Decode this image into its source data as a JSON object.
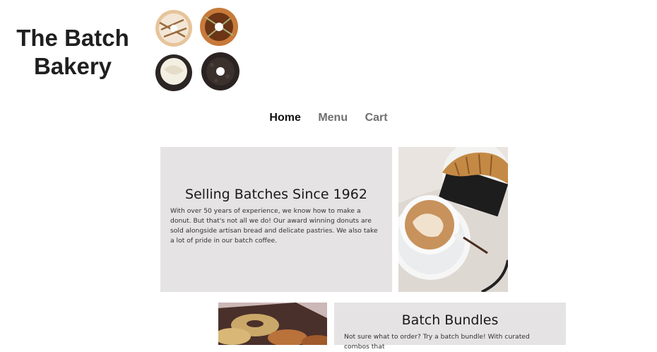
{
  "brand": {
    "title": "The Batch Bakery"
  },
  "nav": {
    "items": [
      {
        "label": "Home",
        "active": true
      },
      {
        "label": "Menu",
        "active": false
      },
      {
        "label": "Cart",
        "active": false
      }
    ]
  },
  "section1": {
    "heading": "Selling Batches Since 1962",
    "body": "With over 50 years of experience, we know how to make a donut. But that's not all we do! Our award winning donuts are sold alongside artisan bread and delicate pastries. We also take a lot of pride in our batch coffee."
  },
  "section2": {
    "heading": "Batch Bundles",
    "body": "Not sure what to order? Try a batch bundle! With curated combos that"
  },
  "colors": {
    "card_bg": "#e5e3e4",
    "nav_active": "#111111",
    "nav_inactive": "#707070"
  }
}
